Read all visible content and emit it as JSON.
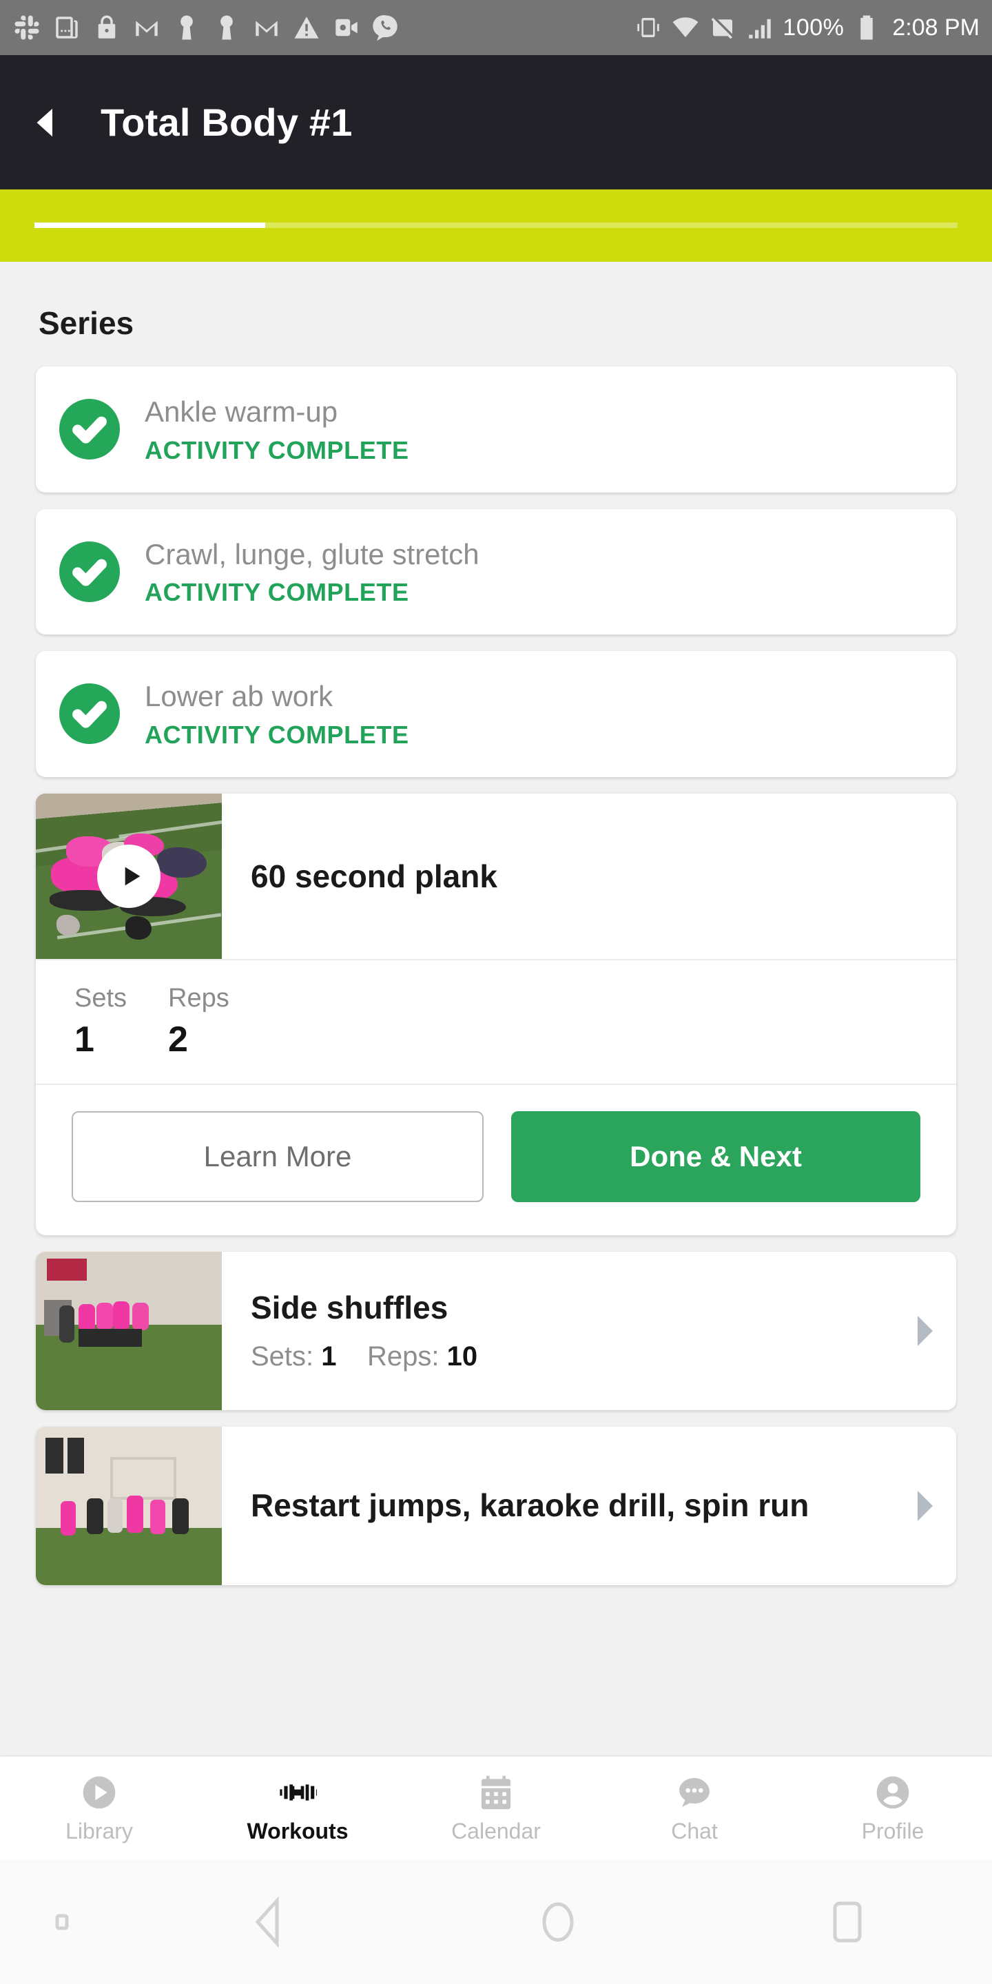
{
  "status_bar": {
    "left_icons": [
      "slack-icon",
      "app-copy-icon",
      "lock-icon",
      "gmail-icon",
      "keyhole-icon",
      "keyhole-icon-2",
      "gmail-icon-2",
      "warning-triangle-icon",
      "video-camera-icon",
      "phone-bubble-icon"
    ],
    "right_icons": [
      "vibrate-icon",
      "wifi-icon",
      "screenshot-off-icon",
      "signal-bars-icon",
      "battery-icon"
    ],
    "battery_percent": "100%",
    "time": "2:08 PM"
  },
  "header": {
    "back_icon": "back-arrow-icon",
    "title": "Total Body #1",
    "bg_color": "#212127"
  },
  "progress": {
    "bar_color": "#cddc0c",
    "fill_color": "#ffffff",
    "percent": 25
  },
  "main": {
    "section_title": "Series",
    "completed": [
      {
        "name": "Ankle warm-up",
        "status": "ACTIVITY COMPLETE",
        "icon": "check-circle-icon"
      },
      {
        "name": "Crawl, lunge, glute stretch",
        "status": "ACTIVITY COMPLETE",
        "icon": "check-circle-icon"
      },
      {
        "name": "Lower ab work",
        "status": "ACTIVITY COMPLETE",
        "icon": "check-circle-icon"
      }
    ],
    "active_exercise": {
      "title": "60 second plank",
      "play_icon": "play-icon",
      "metrics": [
        {
          "label": "Sets",
          "value": "1"
        },
        {
          "label": "Reps",
          "value": "2"
        }
      ],
      "learn_more_label": "Learn More",
      "done_next_label": "Done & Next",
      "primary_color": "#2aa55b"
    },
    "upcoming": [
      {
        "title": "Side shuffles",
        "sets_label": "Sets:",
        "sets_value": "1",
        "reps_label": "Reps:",
        "reps_value": "10",
        "chevron": "chevron-right-icon"
      },
      {
        "title": "Restart jumps, karaoke drill, spin run",
        "sets_label": "",
        "sets_value": "",
        "reps_label": "",
        "reps_value": "",
        "chevron": "chevron-right-icon"
      }
    ]
  },
  "tabbar": {
    "items": [
      {
        "label": "Library",
        "icon": "play-circle-icon",
        "active": false
      },
      {
        "label": "Workouts",
        "icon": "dumbbell-icon",
        "active": true
      },
      {
        "label": "Calendar",
        "icon": "calendar-icon",
        "active": false
      },
      {
        "label": "Chat",
        "icon": "chat-bubble-icon",
        "active": false
      },
      {
        "label": "Profile",
        "icon": "person-icon",
        "active": false
      }
    ]
  },
  "navbar": {
    "items": [
      "keyboard-hide-icon",
      "back-triangle-icon",
      "home-circle-icon",
      "recents-square-icon"
    ]
  }
}
